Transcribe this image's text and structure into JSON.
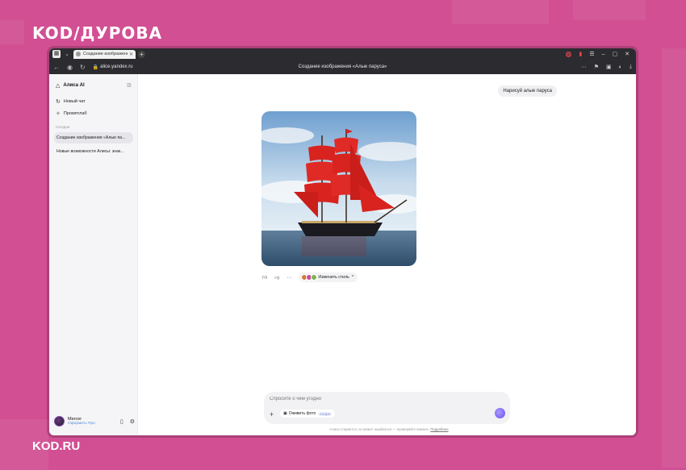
{
  "brand": {
    "logo": "KOD/ДУРОВА",
    "site": "KOD.RU",
    "bg_color": "#d24f93"
  },
  "browser": {
    "tab_title": "Создание изображения«",
    "url": "alice.yandex.ru",
    "page_title": "Создание изображения «Алые паруса»"
  },
  "sidebar": {
    "app_name": "Алиса AI",
    "new_chat": "Новый чат",
    "prompt_lab": "Промптлаб",
    "section_today": "Сегодня",
    "chats": [
      "Создание изображения «Алые па...",
      "Новые возможности Алисы: знак..."
    ],
    "user": {
      "name": "Mercer",
      "subscribe": "Оформить Про"
    }
  },
  "chat": {
    "user_message": "Нарисуй алые паруса",
    "change_style": "Изменить стиль",
    "image_subject": "Sailing ship with red sails at sea"
  },
  "composer": {
    "placeholder": "Спросите о чём угодно",
    "revive_photo": "Оживить фото",
    "soon_badge": "Скоро",
    "disclaimer": "Алиса старается, но может ошибаться — проверяйте важное.",
    "disclaimer_link": "Подробнее"
  }
}
